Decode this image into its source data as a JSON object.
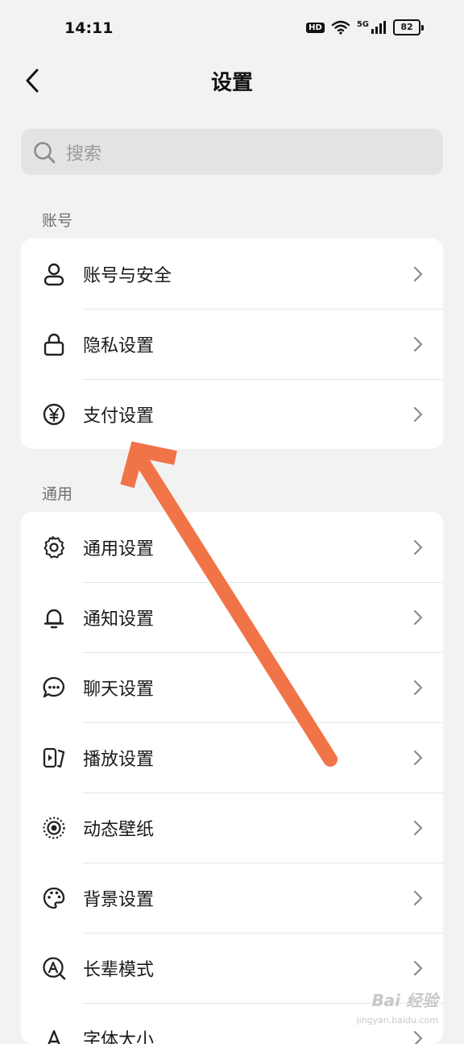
{
  "status_bar": {
    "time": "14:11",
    "hd": "HD",
    "network": "5G",
    "battery": "82"
  },
  "header": {
    "title": "设置"
  },
  "search": {
    "placeholder": "搜索"
  },
  "sections": {
    "account": {
      "label": "账号",
      "items": [
        {
          "label": "账号与安全",
          "icon": "person-icon"
        },
        {
          "label": "隐私设置",
          "icon": "lock-icon"
        },
        {
          "label": "支付设置",
          "icon": "yen-icon"
        }
      ]
    },
    "general": {
      "label": "通用",
      "items": [
        {
          "label": "通用设置",
          "icon": "gear-icon"
        },
        {
          "label": "通知设置",
          "icon": "bell-icon"
        },
        {
          "label": "聊天设置",
          "icon": "chat-bubble-icon"
        },
        {
          "label": "播放设置",
          "icon": "playback-icon"
        },
        {
          "label": "动态壁纸",
          "icon": "live-wallpaper-icon"
        },
        {
          "label": "背景设置",
          "icon": "palette-icon"
        },
        {
          "label": "长辈模式",
          "icon": "elder-mode-icon"
        },
        {
          "label": "字体大小",
          "icon": "font-size-icon"
        }
      ]
    }
  },
  "watermark": {
    "text": "Bai 经验",
    "sub": "jingyan.baidu.com"
  },
  "colors": {
    "arrow": "#f07448",
    "background": "#f2f2f2",
    "card": "#ffffff"
  }
}
